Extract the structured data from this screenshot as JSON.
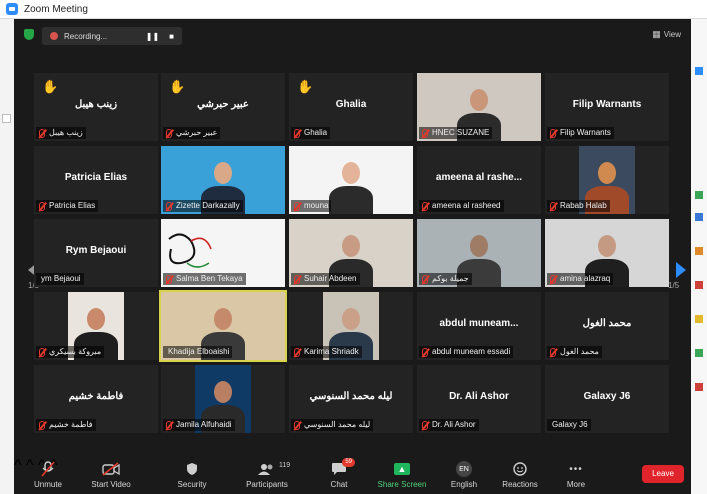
{
  "window": {
    "title": "Zoom Meeting"
  },
  "top": {
    "recording_label": "Recording...",
    "pause_symbol": "❚❚",
    "stop_symbol": "■",
    "view_label": "View"
  },
  "pagination": {
    "left": "1/5",
    "right": "1/5"
  },
  "tiles": [
    {
      "name": "زينب هيبل",
      "label": "زينب هيبل",
      "hand": true,
      "muted": true
    },
    {
      "name": "عبير حبرشي",
      "label": "عبير حبرشي",
      "hand": true,
      "muted": true
    },
    {
      "name": "Ghalia",
      "label": "Ghalia",
      "hand": true,
      "muted": true
    },
    {
      "name": "",
      "label": "HNEC SUZANE",
      "muted": true,
      "video": true
    },
    {
      "name": "Filip Warnants",
      "label": "Filip Warnants",
      "muted": true
    },
    {
      "name": "Patricia Elias",
      "label": "Patricia Elias",
      "muted": true
    },
    {
      "name": "",
      "label": "Zizette Darkazally",
      "muted": true,
      "video": true
    },
    {
      "name": "",
      "label": "mouna",
      "muted": true,
      "video": true
    },
    {
      "name": "ameena al rashe...",
      "label": "ameena al rasheed",
      "muted": true
    },
    {
      "name": "",
      "label": "Rabab Halab",
      "muted": true,
      "video": true
    },
    {
      "name": "Rym Bejaoui",
      "label": "ym Bejaoui",
      "muted": false
    },
    {
      "name": "",
      "label": "Salma Ben Tekaya",
      "muted": true,
      "video": true
    },
    {
      "name": "",
      "label": "Suhair Abdeen",
      "muted": true,
      "video": true
    },
    {
      "name": "",
      "label": "جميلة بوكم",
      "muted": true,
      "video": true
    },
    {
      "name": "",
      "label": "amina alazraq",
      "muted": true,
      "video": true
    },
    {
      "name": "",
      "label": "مبروكة بسيكري",
      "muted": true,
      "video": true
    },
    {
      "name": "",
      "label": "Khadija Elboaishi",
      "muted": false,
      "video": true,
      "active": true
    },
    {
      "name": "",
      "label": "Karima Shriadk",
      "muted": true,
      "video": true
    },
    {
      "name": "abdul muneam...",
      "label": "abdul muneam essadi",
      "muted": true
    },
    {
      "name": "محمد الغول",
      "label": "محمد الغول",
      "muted": true
    },
    {
      "name": "فاطمة خشيم",
      "label": "فاطمة خشيم",
      "muted": true
    },
    {
      "name": "",
      "label": "Jamila Alfuhaidi",
      "muted": true,
      "video": true
    },
    {
      "name": "ليله محمد السنوسي",
      "label": "ليله محمد السنوسي",
      "muted": true
    },
    {
      "name": "Dr. Ali Ashor",
      "label": "Dr. Ali Ashor",
      "muted": true
    },
    {
      "name": "Galaxy J6",
      "label": "Galaxy J6",
      "muted": false
    }
  ],
  "toolbar": {
    "unmute": "Unmute",
    "start_video": "Start Video",
    "security": "Security",
    "participants": "Participants",
    "participants_count": "119",
    "chat": "Chat",
    "chat_badge": "59",
    "share_screen": "Share Screen",
    "language_code": "EN",
    "english": "English",
    "reactions": "Reactions",
    "more": "More",
    "leave": "Leave",
    "more_glyph": "•••"
  },
  "colors": {
    "accent": "#2d8cff",
    "leave": "#e0242b",
    "share": "#1fb55c",
    "muted": "#e3392c",
    "active_speaker": "#d9d24b"
  }
}
